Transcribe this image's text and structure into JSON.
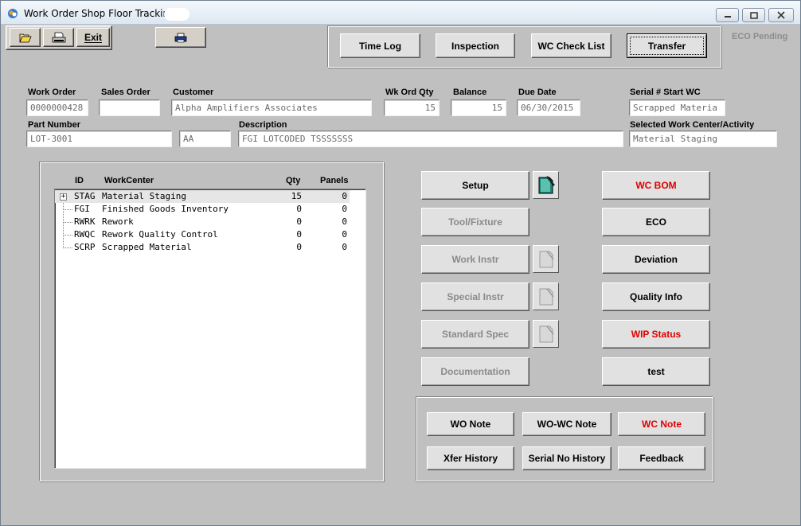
{
  "window": {
    "title": "Work Order Shop Floor Tracking"
  },
  "toolbar": {
    "open_icon": "folder-open-icon",
    "print_icon": "printer-icon",
    "exit_label": "Exit",
    "print2_icon": "printer-icon"
  },
  "top_buttons": {
    "time_log": "Time Log",
    "inspection": "Inspection",
    "wc_check_list": "WC Check List",
    "transfer": "Transfer"
  },
  "eco_pending": "ECO Pending",
  "header_fields": {
    "work_order": {
      "label": "Work Order",
      "value": "0000000428"
    },
    "sales_order": {
      "label": "Sales Order",
      "value": ""
    },
    "customer": {
      "label": "Customer",
      "value": "Alpha Amplifiers Associates"
    },
    "wk_ord_qty": {
      "label": "Wk Ord Qty",
      "value": "15"
    },
    "balance": {
      "label": "Balance",
      "value": "15"
    },
    "due_date": {
      "label": "Due Date",
      "value": "06/30/2015"
    },
    "serial_start_wc": {
      "label": "Serial # Start WC",
      "value": "Scrapped Materia"
    },
    "part_number": {
      "label": "Part Number",
      "value": "LOT-3001"
    },
    "revision": {
      "value": "AA"
    },
    "description": {
      "label": "Description",
      "value": "FGI LOTCODED TSSSSSSS"
    },
    "selected_wc": {
      "label": "Selected Work Center/Activity",
      "value": "Material Staging"
    }
  },
  "workcenter_list": {
    "headers": {
      "id": "ID",
      "workcenter": "WorkCenter",
      "qty": "Qty",
      "panels": "Panels"
    },
    "rows": [
      {
        "id": "STAG",
        "name": "Material Staging",
        "qty": "15",
        "panels": "0",
        "expander": "+"
      },
      {
        "id": "FGI",
        "name": "Finished Goods Inventory",
        "qty": "0",
        "panels": "0"
      },
      {
        "id": "RWRK",
        "name": "Rework",
        "qty": "0",
        "panels": "0"
      },
      {
        "id": "RWQC",
        "name": "Rework Quality Control",
        "qty": "0",
        "panels": "0"
      },
      {
        "id": "SCRP",
        "name": "Scrapped Material",
        "qty": "0",
        "panels": "0"
      }
    ]
  },
  "activity_buttons": {
    "setup": "Setup",
    "tool_fixture": "Tool/Fixture",
    "work_instr": "Work Instr",
    "special_instr": "Special Instr",
    "standard_spec": "Standard Spec",
    "documentation": "Documentation"
  },
  "right_buttons": {
    "wc_bom": "WC BOM",
    "eco": "ECO",
    "deviation": "Deviation",
    "quality_info": "Quality Info",
    "wip_status": "WIP Status",
    "test": "test"
  },
  "note_buttons": {
    "wo_note": "WO Note",
    "wo_wc_note": "WO-WC Note",
    "wc_note": "WC Note",
    "xfer_history": "Xfer History",
    "serial_no_history": "Serial No History",
    "feedback": "Feedback"
  },
  "colors": {
    "red_text": "#e00000",
    "disabled_text": "#8a8a8a",
    "window_bg": "#c0c0c0"
  }
}
